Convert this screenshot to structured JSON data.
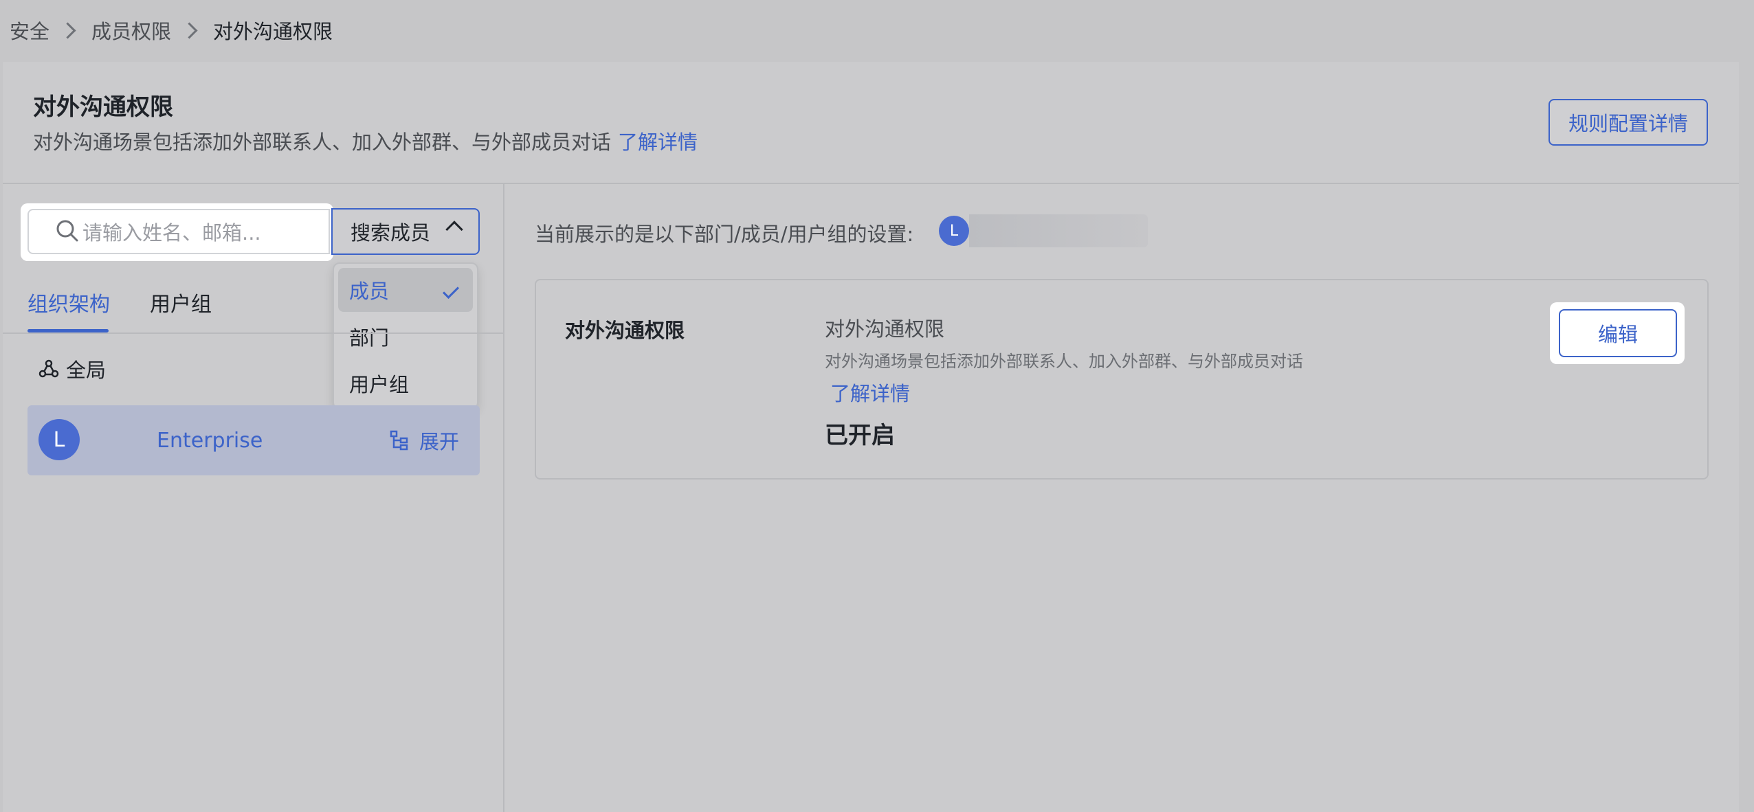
{
  "breadcrumb": {
    "items": [
      "安全",
      "成员权限",
      "对外沟通权限"
    ]
  },
  "header": {
    "title": "对外沟通权限",
    "description": "对外沟通场景包括添加外部联系人、加入外部群、与外部成员对话",
    "learn_more": "了解详情",
    "rule_button": "规则配置详情"
  },
  "search": {
    "placeholder": "请输入姓名、邮箱...",
    "type_label": "搜索成员",
    "options": [
      "成员",
      "部门",
      "用户组"
    ],
    "selected": "成员"
  },
  "tabs": [
    "组织架构",
    "用户组"
  ],
  "tree": {
    "global_label": "全局",
    "org": {
      "avatar_letter": "L",
      "name": "Enterprise",
      "expand_label": "展开"
    }
  },
  "current": {
    "label": "当前展示的是以下部门/成员/用户组的设置:",
    "avatar_letter": "L"
  },
  "card": {
    "title": "对外沟通权限",
    "sub_title": "对外沟通权限",
    "sub_desc": "对外沟通场景包括添加外部联系人、加入外部群、与外部成员对话",
    "learn_more": "了解详情",
    "status": "已开启",
    "edit_button": "编辑"
  },
  "colors": {
    "accent": "#3c63c9",
    "background": "#c6c6c8"
  }
}
